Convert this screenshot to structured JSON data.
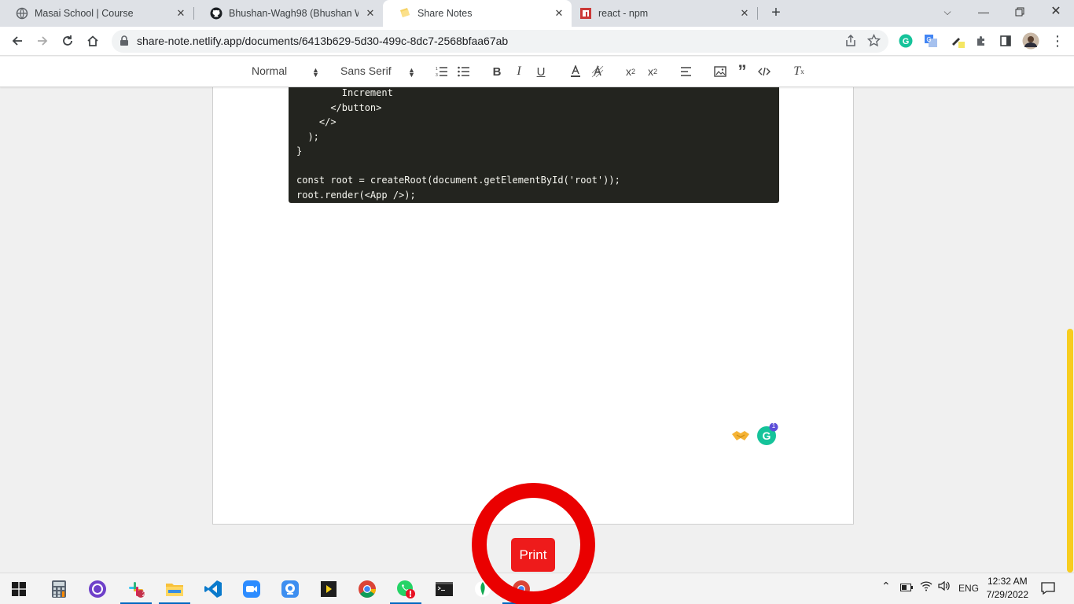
{
  "browser": {
    "tabs": [
      {
        "title": "Masai School | Course",
        "icon": "globe-icon"
      },
      {
        "title": "Bhushan-Wagh98 (Bhushan Wag",
        "icon": "github-icon"
      },
      {
        "title": "Share Notes",
        "icon": "note-icon"
      },
      {
        "title": "react - npm",
        "icon": "npm-icon"
      }
    ],
    "url": "share-note.netlify.app/documents/6413b629-5d30-499c-8dc7-2568bfaa67ab"
  },
  "editor": {
    "heading_select": "Normal",
    "font_select": "Sans Serif",
    "code_lines": [
      "        Increment",
      "      </button>",
      "    </>",
      "  );",
      "}",
      "",
      "const root = createRoot(document.getElementById('root'));",
      "root.render(<App />);"
    ]
  },
  "print_label": "Print",
  "grammarly_badge": "1",
  "taskbar": {
    "slack_badge": "2",
    "language": "ENG",
    "time": "12:32 AM",
    "date": "7/29/2022"
  },
  "colors": {
    "accent_red": "#ea0000",
    "code_bg": "#23241f",
    "scroll_thumb": "#f7cd1f"
  }
}
